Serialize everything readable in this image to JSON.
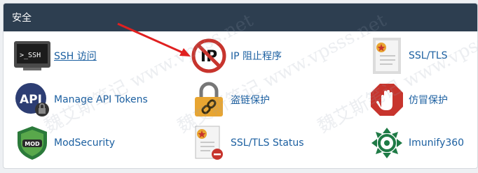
{
  "panel": {
    "title": "安全"
  },
  "items": [
    {
      "id": "ssh",
      "label": "SSH 访问",
      "icon": "terminal-ssh-icon"
    },
    {
      "id": "ipb",
      "label": "IP 阻止程序",
      "icon": "ip-blocker-icon"
    },
    {
      "id": "ssl",
      "label": "SSL/TLS",
      "icon": "certificate-icon"
    },
    {
      "id": "api",
      "label": "Manage API Tokens",
      "icon": "api-lock-icon"
    },
    {
      "id": "hot",
      "label": "盗链保护",
      "icon": "padlock-chain-icon"
    },
    {
      "id": "lee",
      "label": "仿冒保护",
      "icon": "stop-hand-icon"
    },
    {
      "id": "mod",
      "label": "ModSecurity",
      "icon": "modsecurity-shield-icon"
    },
    {
      "id": "sls",
      "label": "SSL/TLS Status",
      "icon": "certificate-status-icon"
    },
    {
      "id": "imu",
      "label": "Imunify360",
      "icon": "imunify360-logo-icon"
    }
  ],
  "terminal_text": ">_SSH",
  "api_text": "API",
  "ip_text": "IP",
  "mod_text": "MOD",
  "watermark": "魏艾斯笔记 www.vpsss.net",
  "colors": {
    "header_bg": "#2d3e50",
    "link": "#1b5fa0",
    "red": "#c7342d",
    "gold": "#e8a531",
    "green": "#1e7a45"
  }
}
